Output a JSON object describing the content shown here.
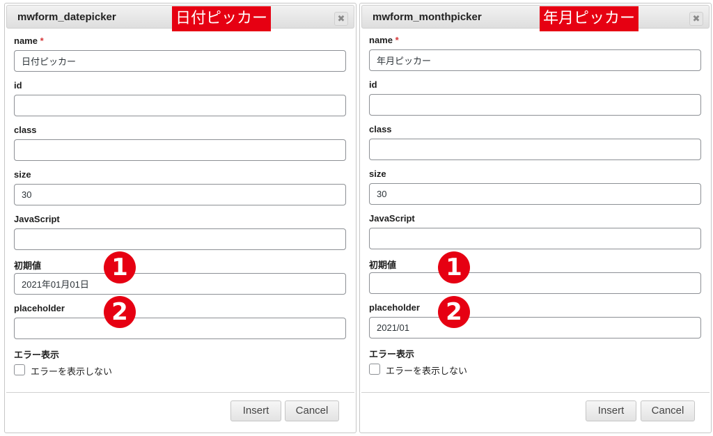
{
  "dialogs": [
    {
      "title": "mwform_datepicker",
      "badge": "日付ピッカー",
      "close": "✖",
      "fields": {
        "name_label": "name",
        "name_required": "*",
        "name_value": "日付ピッカー",
        "id_label": "id",
        "id_value": "",
        "class_label": "class",
        "class_value": "",
        "size_label": "size",
        "size_value": "30",
        "js_label": "JavaScript",
        "js_value": "",
        "initial_label": "初期値",
        "initial_value": "2021年01月01日",
        "placeholder_label": "placeholder",
        "placeholder_value": ""
      },
      "error_label": "エラー表示",
      "error_checkbox": "エラーを表示しない",
      "insert": "Insert",
      "cancel": "Cancel",
      "step1": "1",
      "step2": "2"
    },
    {
      "title": "mwform_monthpicker",
      "badge": "年月ピッカー",
      "close": "✖",
      "fields": {
        "name_label": "name",
        "name_required": "*",
        "name_value": "年月ピッカー",
        "id_label": "id",
        "id_value": "",
        "class_label": "class",
        "class_value": "",
        "size_label": "size",
        "size_value": "30",
        "js_label": "JavaScript",
        "js_value": "",
        "initial_label": "初期値",
        "initial_value": "",
        "placeholder_label": "placeholder",
        "placeholder_value": "2021/01"
      },
      "error_label": "エラー表示",
      "error_checkbox": "エラーを表示しない",
      "insert": "Insert",
      "cancel": "Cancel",
      "step1": "1",
      "step2": "2"
    }
  ],
  "colors": {
    "badge_red": "#e60012",
    "required_red": "#d63638",
    "input_border": "#8c8f94"
  }
}
